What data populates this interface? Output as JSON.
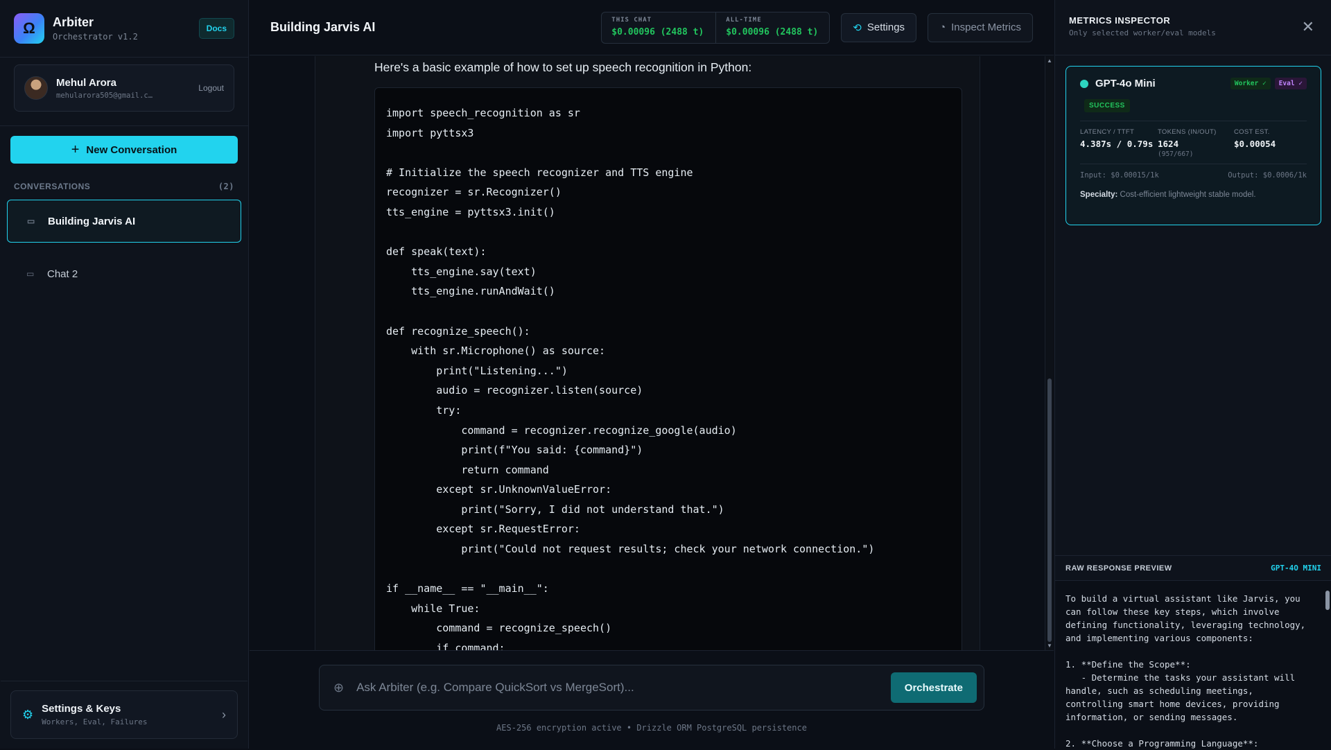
{
  "brand": {
    "name": "Arbiter",
    "version": "Orchestrator v1.2",
    "logo_glyph": "Ω",
    "docs_label": "Docs"
  },
  "user": {
    "name": "Mehul Arora",
    "email": "mehularora505@gmail.c…",
    "logout_label": "Logout"
  },
  "sidebar": {
    "new_conversation_label": "New Conversation",
    "conversations_heading": "CONVERSATIONS",
    "conversations_count": "(2)",
    "conversations": [
      {
        "title": "Building Jarvis AI",
        "active": true
      },
      {
        "title": "Chat 2",
        "active": false
      }
    ],
    "settings": {
      "title": "Settings & Keys",
      "subtitle": "Workers, Eval, Failures"
    }
  },
  "header": {
    "chat_title": "Building Jarvis AI",
    "this_chat_label": "THIS CHAT",
    "this_chat_value": "$0.00096 (2488 t)",
    "all_time_label": "ALL-TIME",
    "all_time_value": "$0.00096 (2488 t)",
    "settings_label": "Settings",
    "inspect_label": "Inspect Metrics"
  },
  "message": {
    "intro": "Here's a basic example of how to set up speech recognition in Python:",
    "code": "import speech_recognition as sr\nimport pyttsx3\n\n# Initialize the speech recognizer and TTS engine\nrecognizer = sr.Recognizer()\ntts_engine = pyttsx3.init()\n\ndef speak(text):\n    tts_engine.say(text)\n    tts_engine.runAndWait()\n\ndef recognize_speech():\n    with sr.Microphone() as source:\n        print(\"Listening...\")\n        audio = recognizer.listen(source)\n        try:\n            command = recognizer.recognize_google(audio)\n            print(f\"You said: {command}\")\n            return command\n        except sr.UnknownValueError:\n            print(\"Sorry, I did not understand that.\")\n        except sr.RequestError:\n            print(\"Could not request results; check your network connection.\")\n\nif __name__ == \"__main__\":\n    while True:\n        command = recognize_speech()\n        if command:"
  },
  "composer": {
    "placeholder": "Ask Arbiter (e.g. Compare QuickSort vs MergeSort)...",
    "submit_label": "Orchestrate",
    "footer": "AES-256 encryption active • Drizzle ORM PostgreSQL persistence"
  },
  "inspector": {
    "title": "METRICS INSPECTOR",
    "subtitle": "Only selected worker/eval models",
    "model": {
      "name": "GPT-4o Mini",
      "worker_tag": "Worker ✓",
      "eval_tag": "Eval ✓",
      "status": "SUCCESS",
      "latency_label": "LATENCY / TTFT",
      "latency_value": "4.387s / 0.79s",
      "tokens_label": "TOKENS (IN/OUT)",
      "tokens_value": "1624",
      "tokens_sub": "(957/667)",
      "cost_label": "COST EST.",
      "cost_value": "$0.00054",
      "input_price": "Input: $0.00015/1k",
      "output_price": "Output: $0.0006/1k",
      "specialty_label": "Specialty:",
      "specialty_value": "Cost-efficient lightweight stable model."
    },
    "raw": {
      "title": "RAW RESPONSE PREVIEW",
      "model": "GPT-4O MINI",
      "text": "To build a virtual assistant like Jarvis, you can follow these key steps, which involve defining functionality, leveraging technology, and implementing various components:\n\n1. **Define the Scope**:\n   - Determine the tasks your assistant will handle, such as scheduling meetings, controlling smart home devices, providing information, or sending messages.\n\n2. **Choose a Programming Language**:"
    }
  },
  "colors": {
    "accent": "#22d3ee",
    "success": "#22c55e",
    "eval": "#c084fc"
  }
}
